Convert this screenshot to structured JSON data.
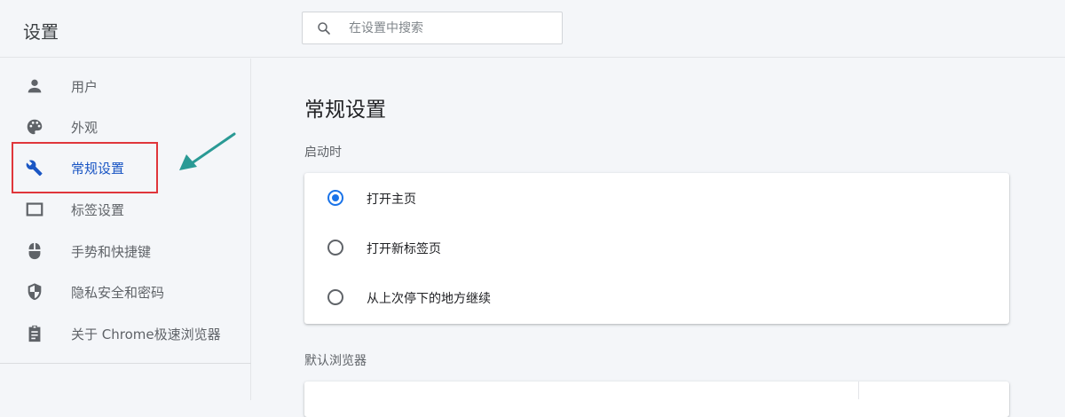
{
  "header": {
    "title": "设置",
    "search_placeholder": "在设置中搜索",
    "search_icon": "search-icon"
  },
  "sidebar": {
    "items": [
      {
        "label": "用户",
        "icon": "person-icon"
      },
      {
        "label": "外观",
        "icon": "palette-icon"
      },
      {
        "label": "常规设置",
        "icon": "wrench-icon",
        "active": true
      },
      {
        "label": "标签设置",
        "icon": "tab-icon"
      },
      {
        "label": "手势和快捷键",
        "icon": "mouse-icon"
      },
      {
        "label": "隐私安全和密码",
        "icon": "shield-icon"
      },
      {
        "label": "关于 Chrome极速浏览器",
        "icon": "clipboard-icon"
      }
    ]
  },
  "main": {
    "title": "常规设置",
    "startup": {
      "label": "启动时",
      "options": [
        {
          "label": "打开主页",
          "checked": true
        },
        {
          "label": "打开新标签页",
          "checked": false
        },
        {
          "label": "从上次停下的地方继续",
          "checked": false
        }
      ]
    },
    "default_browser": {
      "label": "默认浏览器"
    }
  },
  "colors": {
    "accent": "#1a73e8",
    "annotation_box": "#e0363b",
    "annotation_arrow": "#2a9a95"
  }
}
